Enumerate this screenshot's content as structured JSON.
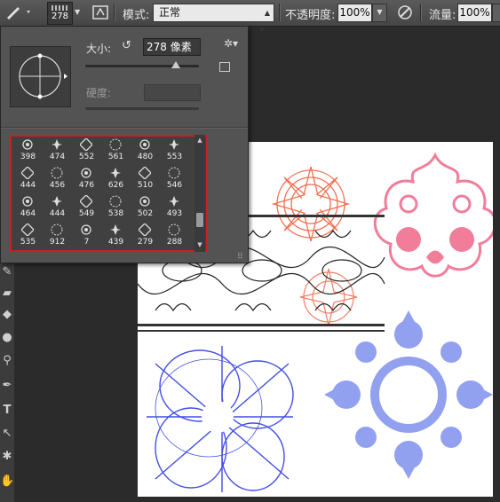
{
  "options_bar": {
    "brush_size": "278",
    "mode_label": "模式:",
    "mode_value": "正常",
    "opacity_label": "不透明度:",
    "opacity_value": "100%",
    "flow_label": "流量:",
    "flow_value": "100%"
  },
  "brush_picker": {
    "size_label": "大小:",
    "size_value": "278 像素",
    "hardness_label": "硬度:",
    "size_slider_fraction": 0.8,
    "brushes": [
      {
        "num": "398"
      },
      {
        "num": "474"
      },
      {
        "num": "552"
      },
      {
        "num": "561"
      },
      {
        "num": "480"
      },
      {
        "num": "553"
      },
      {
        "num": "444"
      },
      {
        "num": "456"
      },
      {
        "num": "476"
      },
      {
        "num": "626"
      },
      {
        "num": "510"
      },
      {
        "num": "546"
      },
      {
        "num": "464"
      },
      {
        "num": "444"
      },
      {
        "num": "549"
      },
      {
        "num": "538"
      },
      {
        "num": "502"
      },
      {
        "num": "493"
      },
      {
        "num": "535"
      },
      {
        "num": "912"
      },
      {
        "num": "7"
      },
      {
        "num": "439"
      },
      {
        "num": "279"
      },
      {
        "num": "288"
      }
    ]
  },
  "colors": {
    "highlight_border": "#cc1f1f",
    "stamp_orange": "#f06040",
    "stamp_pink": "#f06080",
    "stamp_blue": "#2030e0",
    "stamp_lightblue": "#8090ee"
  }
}
